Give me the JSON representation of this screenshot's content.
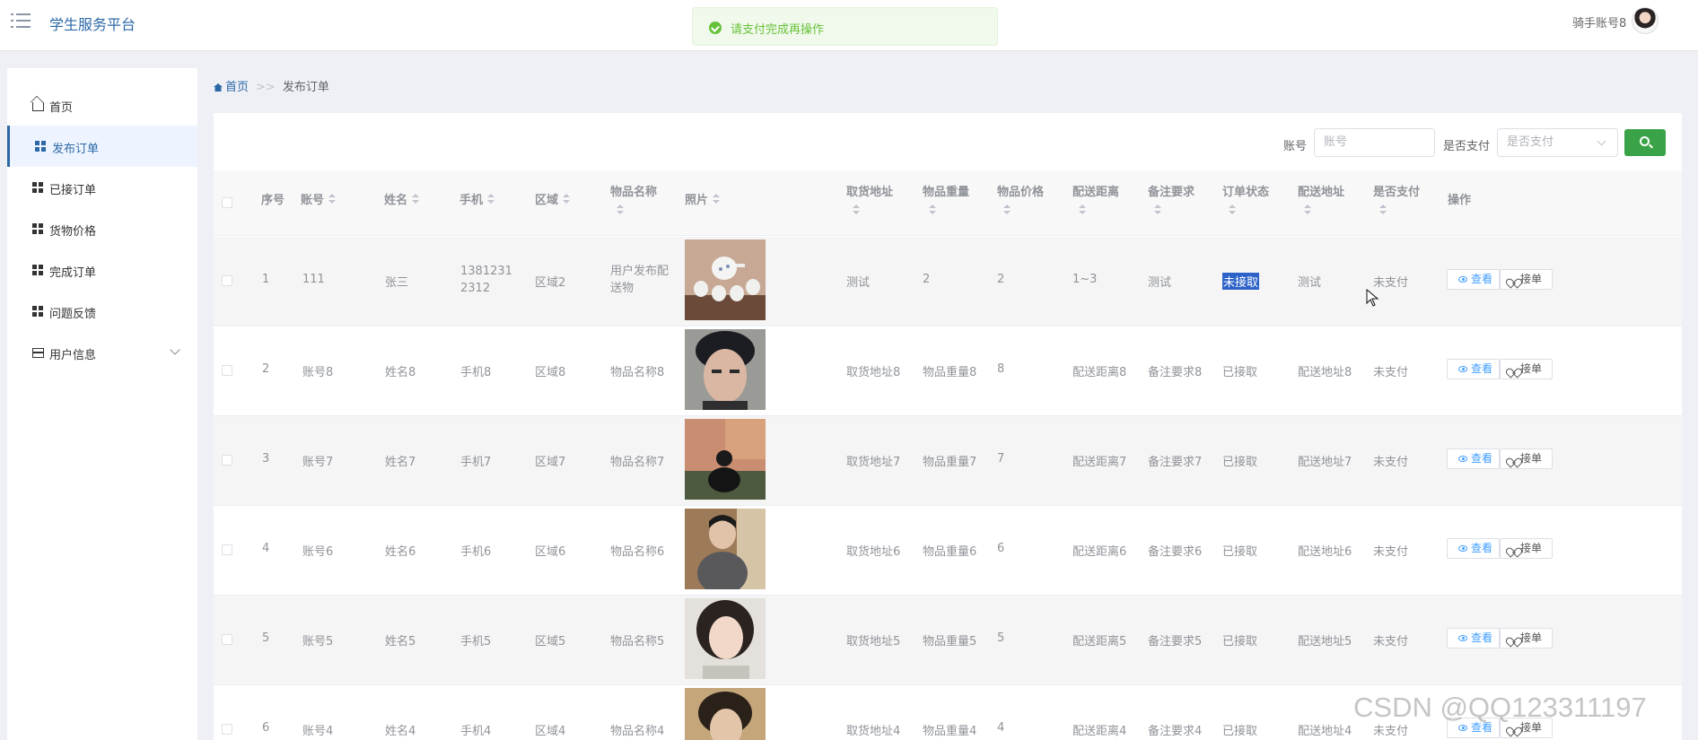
{
  "header": {
    "app_title": "学生服务平台",
    "toast": "请支付完成再操作",
    "user": "骑手账号8"
  },
  "sidebar": {
    "items": [
      {
        "label": "首页"
      },
      {
        "label": "发布订单"
      },
      {
        "label": "已接订单"
      },
      {
        "label": "货物价格"
      },
      {
        "label": "完成订单"
      },
      {
        "label": "问题反馈"
      },
      {
        "label": "用户信息"
      }
    ]
  },
  "breadcrumb": {
    "home": "首页",
    "separator": ">>",
    "current": "发布订单"
  },
  "search": {
    "account_label": "账号",
    "account_placeholder": "账号",
    "paid_label": "是否支付",
    "paid_placeholder": "是否支付"
  },
  "table": {
    "headers": {
      "seq": "序号",
      "account": "账号",
      "name": "姓名",
      "phone": "手机",
      "area": "区域",
      "item": "物品名称",
      "photo": "照片",
      "pickup": "取货地址",
      "weight": "物品重量",
      "price": "物品价格",
      "distance": "配送距离",
      "remark": "备注要求",
      "status": "订单状态",
      "delivery": "配送地址",
      "paid": "是否支付",
      "action": "操作"
    },
    "view_label": "查看",
    "take_label": "接单",
    "rows": [
      {
        "seq": "1",
        "account": "111",
        "name": "张三",
        "phone": "13812312312",
        "area": "区域2",
        "item": "用户发布配送物",
        "pickup": "测试",
        "weight": "2",
        "price": "2",
        "distance": "1~3",
        "remark": "测试",
        "status": "未接取",
        "delivery": "测试",
        "paid": "未支付"
      },
      {
        "seq": "2",
        "account": "账号8",
        "name": "姓名8",
        "phone": "手机8",
        "area": "区域8",
        "item": "物品名称8",
        "pickup": "取货地址8",
        "weight": "物品重量8",
        "price": "8",
        "distance": "配送距离8",
        "remark": "备注要求8",
        "status": "已接取",
        "delivery": "配送地址8",
        "paid": "未支付"
      },
      {
        "seq": "3",
        "account": "账号7",
        "name": "姓名7",
        "phone": "手机7",
        "area": "区域7",
        "item": "物品名称7",
        "pickup": "取货地址7",
        "weight": "物品重量7",
        "price": "7",
        "distance": "配送距离7",
        "remark": "备注要求7",
        "status": "已接取",
        "delivery": "配送地址7",
        "paid": "未支付"
      },
      {
        "seq": "4",
        "account": "账号6",
        "name": "姓名6",
        "phone": "手机6",
        "area": "区域6",
        "item": "物品名称6",
        "pickup": "取货地址6",
        "weight": "物品重量6",
        "price": "6",
        "distance": "配送距离6",
        "remark": "备注要求6",
        "status": "已接取",
        "delivery": "配送地址6",
        "paid": "未支付"
      },
      {
        "seq": "5",
        "account": "账号5",
        "name": "姓名5",
        "phone": "手机5",
        "area": "区域5",
        "item": "物品名称5",
        "pickup": "取货地址5",
        "weight": "物品重量5",
        "price": "5",
        "distance": "配送距离5",
        "remark": "备注要求5",
        "status": "已接取",
        "delivery": "配送地址5",
        "paid": "未支付"
      },
      {
        "seq": "6",
        "account": "账号4",
        "name": "姓名4",
        "phone": "手机4",
        "area": "区域4",
        "item": "物品名称4",
        "pickup": "取货地址4",
        "weight": "物品重量4",
        "price": "4",
        "distance": "配送距离4",
        "remark": "备注要求4",
        "status": "已接取",
        "delivery": "配送地址4",
        "paid": "未支付"
      }
    ]
  },
  "watermark": "CSDN @QQ123311197",
  "colors": {
    "brand": "#2c68a7",
    "success": "#67c23a",
    "search_button": "#3aa347",
    "link": "#409eff"
  }
}
